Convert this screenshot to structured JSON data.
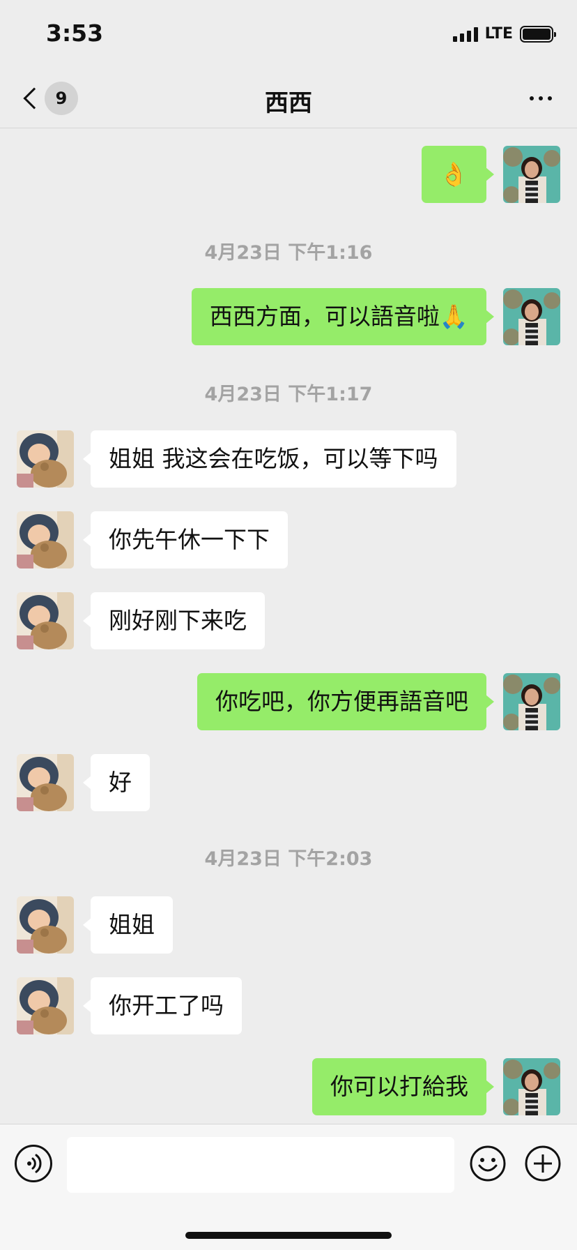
{
  "status_bar": {
    "time": "3:53",
    "network": "LTE"
  },
  "nav": {
    "unread_count": "9",
    "title": "西西"
  },
  "messages": [
    {
      "id": "m1",
      "direction": "out",
      "text": "👌"
    },
    {
      "id": "t1",
      "type": "timestamp",
      "text": "4月23日 下午1:16"
    },
    {
      "id": "m2",
      "direction": "out",
      "text": "西西方面，可以語音啦🙏"
    },
    {
      "id": "t2",
      "type": "timestamp",
      "text": "4月23日 下午1:17"
    },
    {
      "id": "m3",
      "direction": "in",
      "text": "姐姐  我这会在吃饭，可以等下吗"
    },
    {
      "id": "m4",
      "direction": "in",
      "text": "你先午休一下下"
    },
    {
      "id": "m5",
      "direction": "in",
      "text": "刚好刚下来吃"
    },
    {
      "id": "m6",
      "direction": "out",
      "text": "你吃吧，你方便再語音吧"
    },
    {
      "id": "m7",
      "direction": "in",
      "text": "好"
    },
    {
      "id": "t3",
      "type": "timestamp",
      "text": "4月23日 下午2:03"
    },
    {
      "id": "m8",
      "direction": "in",
      "text": "姐姐"
    },
    {
      "id": "m9",
      "direction": "in",
      "text": "你开工了吗"
    },
    {
      "id": "m10",
      "direction": "out",
      "text": "你可以打給我"
    }
  ],
  "input": {
    "placeholder": ""
  },
  "icons": {
    "back": "chevron-left-icon",
    "more": "more-dots-icon",
    "voice": "voice-icon",
    "emoji": "emoji-icon",
    "plus": "plus-icon"
  },
  "colors": {
    "outgoing_bubble": "#95ec69",
    "incoming_bubble": "#ffffff",
    "background": "#ededed"
  }
}
